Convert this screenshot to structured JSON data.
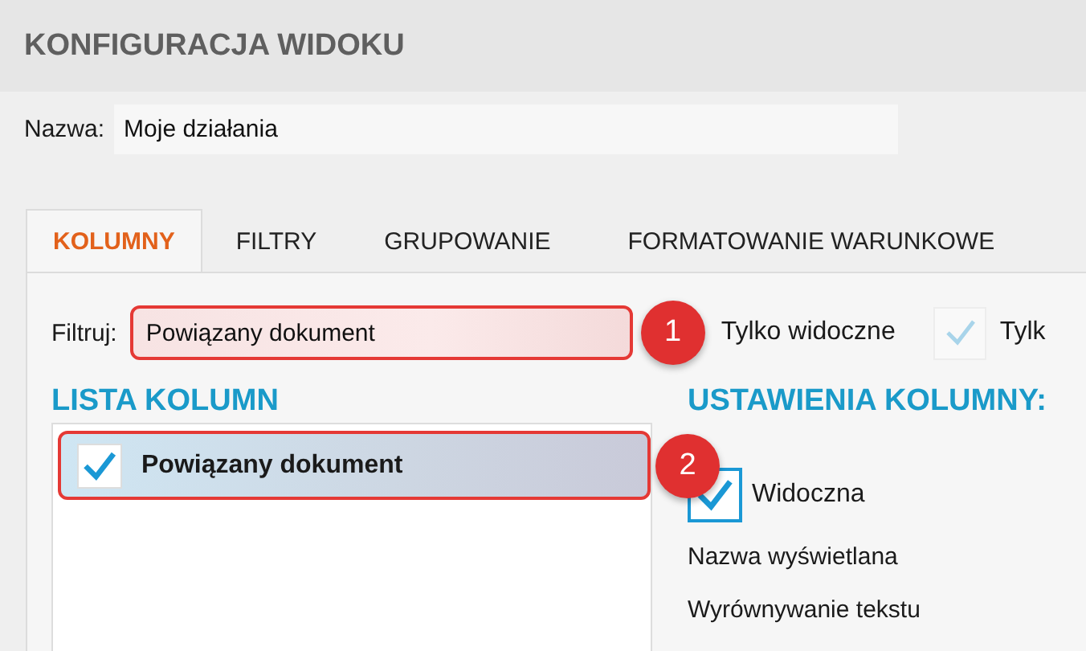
{
  "title": "KONFIGURACJA WIDOKU",
  "name_field": {
    "label": "Nazwa:",
    "value": "Moje działania"
  },
  "tabs": [
    {
      "label": "KOLUMNY",
      "selected": true
    },
    {
      "label": "FILTRY",
      "selected": false
    },
    {
      "label": "GRUPOWANIE",
      "selected": false
    },
    {
      "label": "FORMATOWANIE WARUNKOWE",
      "selected": false
    }
  ],
  "filter": {
    "label": "Filtruj:",
    "value": "Powiązany dokument",
    "highlighted": true,
    "callout": "1"
  },
  "options": [
    {
      "label": "Tylko widoczne"
    },
    {
      "label": "Tylk",
      "checked": true,
      "disabled": true
    }
  ],
  "column_list": {
    "heading": "LISTA KOLUMN",
    "items": [
      {
        "label": "Powiązany dokument",
        "checked": true,
        "selected": true,
        "highlighted": true,
        "callout": "2"
      }
    ]
  },
  "column_settings": {
    "heading": "USTAWIENIA KOLUMNY:",
    "visible": {
      "label": "Widoczna",
      "checked": true
    },
    "fields": [
      "Nazwa wyświetlana",
      "Wyrównywanie tekstu"
    ]
  }
}
